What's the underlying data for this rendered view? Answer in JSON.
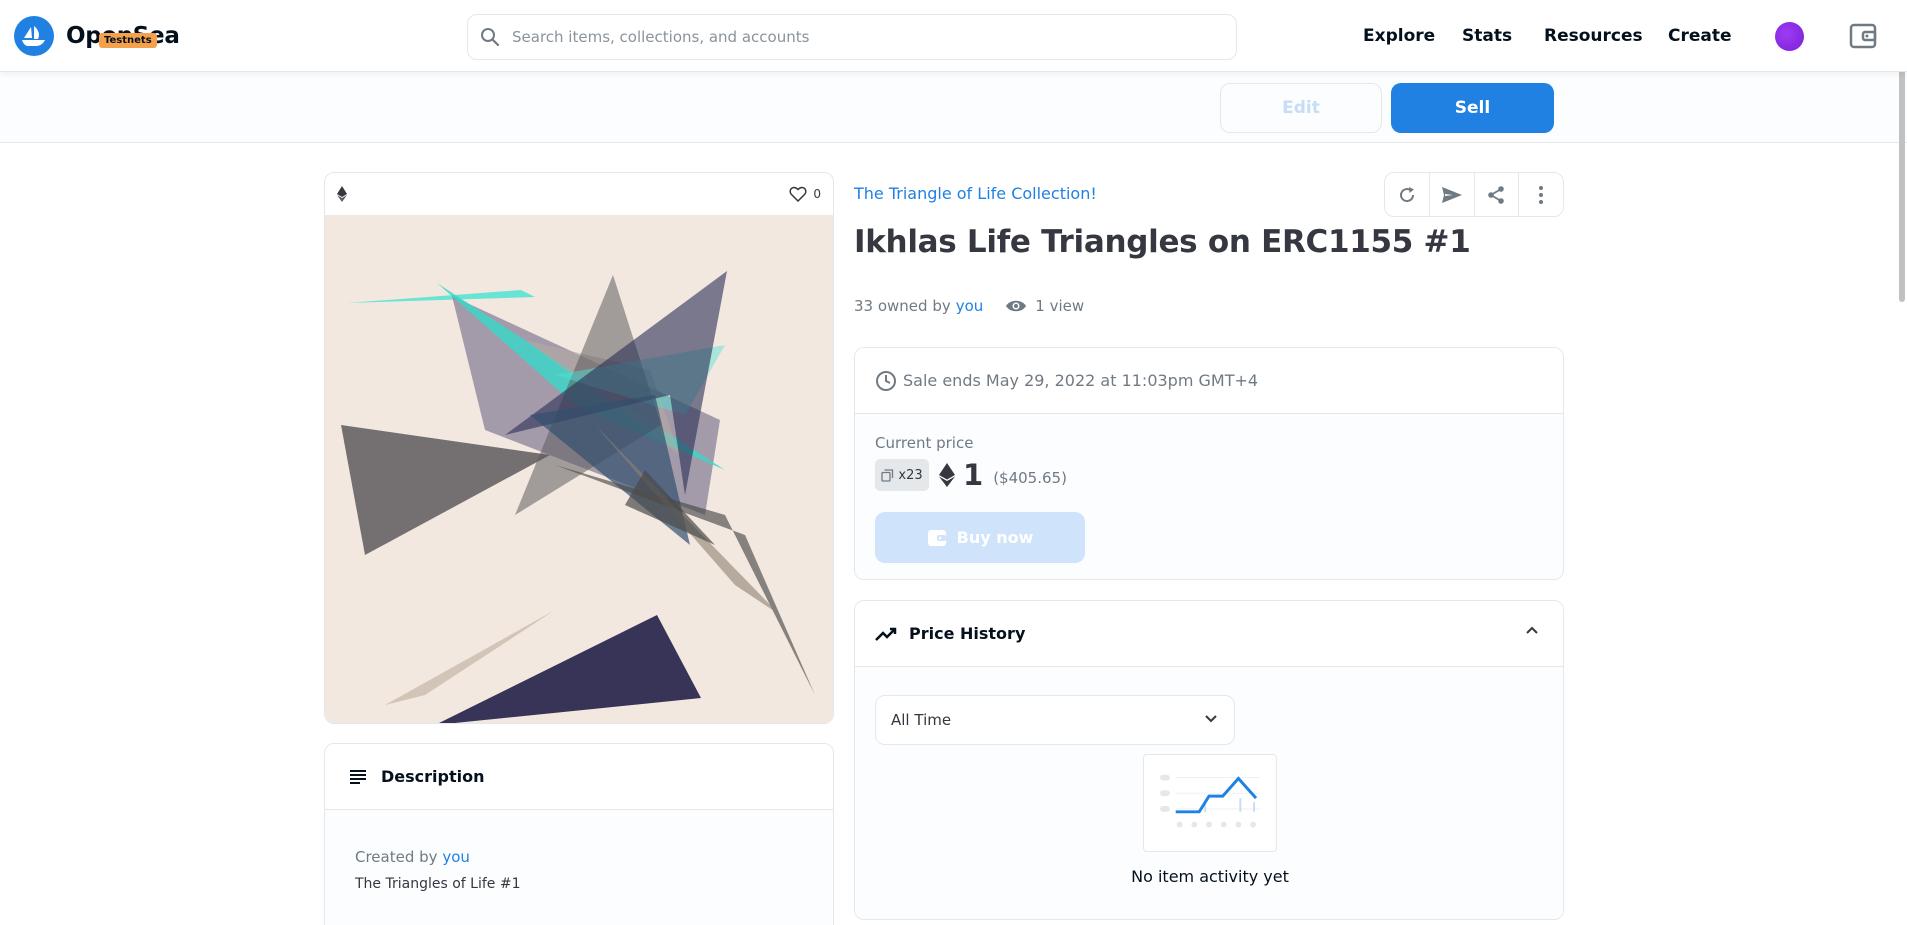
{
  "header": {
    "logo_text": "OpenSea",
    "badge": "Testnets",
    "search_placeholder": "Search items, collections, and accounts",
    "nav": [
      "Explore",
      "Stats",
      "Resources",
      "Create"
    ]
  },
  "toolbar": {
    "edit_label": "Edit",
    "sell_label": "Sell"
  },
  "asset_card": {
    "likes": "0"
  },
  "description": {
    "title": "Description",
    "created_by_prefix": "Created by",
    "created_by_user": "you",
    "text": "The Triangles of Life #1"
  },
  "item": {
    "collection": "The Triangle of Life Collection!",
    "title": "Ikhlas Life Triangles on ERC1155 #1",
    "owned_text": "33 owned by",
    "owner": "you",
    "views": "1 view"
  },
  "sale": {
    "ends": "Sale ends May 29, 2022 at 11:03pm GMT+4",
    "current_price_label": "Current price",
    "quantity": "x23",
    "price": "1",
    "price_usd": "($405.65)",
    "buy_label": "Buy now"
  },
  "price_history": {
    "title": "Price History",
    "range": "All Time",
    "empty_text": "No item activity yet"
  },
  "colors": {
    "accent": "#2081e2",
    "badge": "#f5a04a",
    "avatar": "#8a2be2"
  }
}
